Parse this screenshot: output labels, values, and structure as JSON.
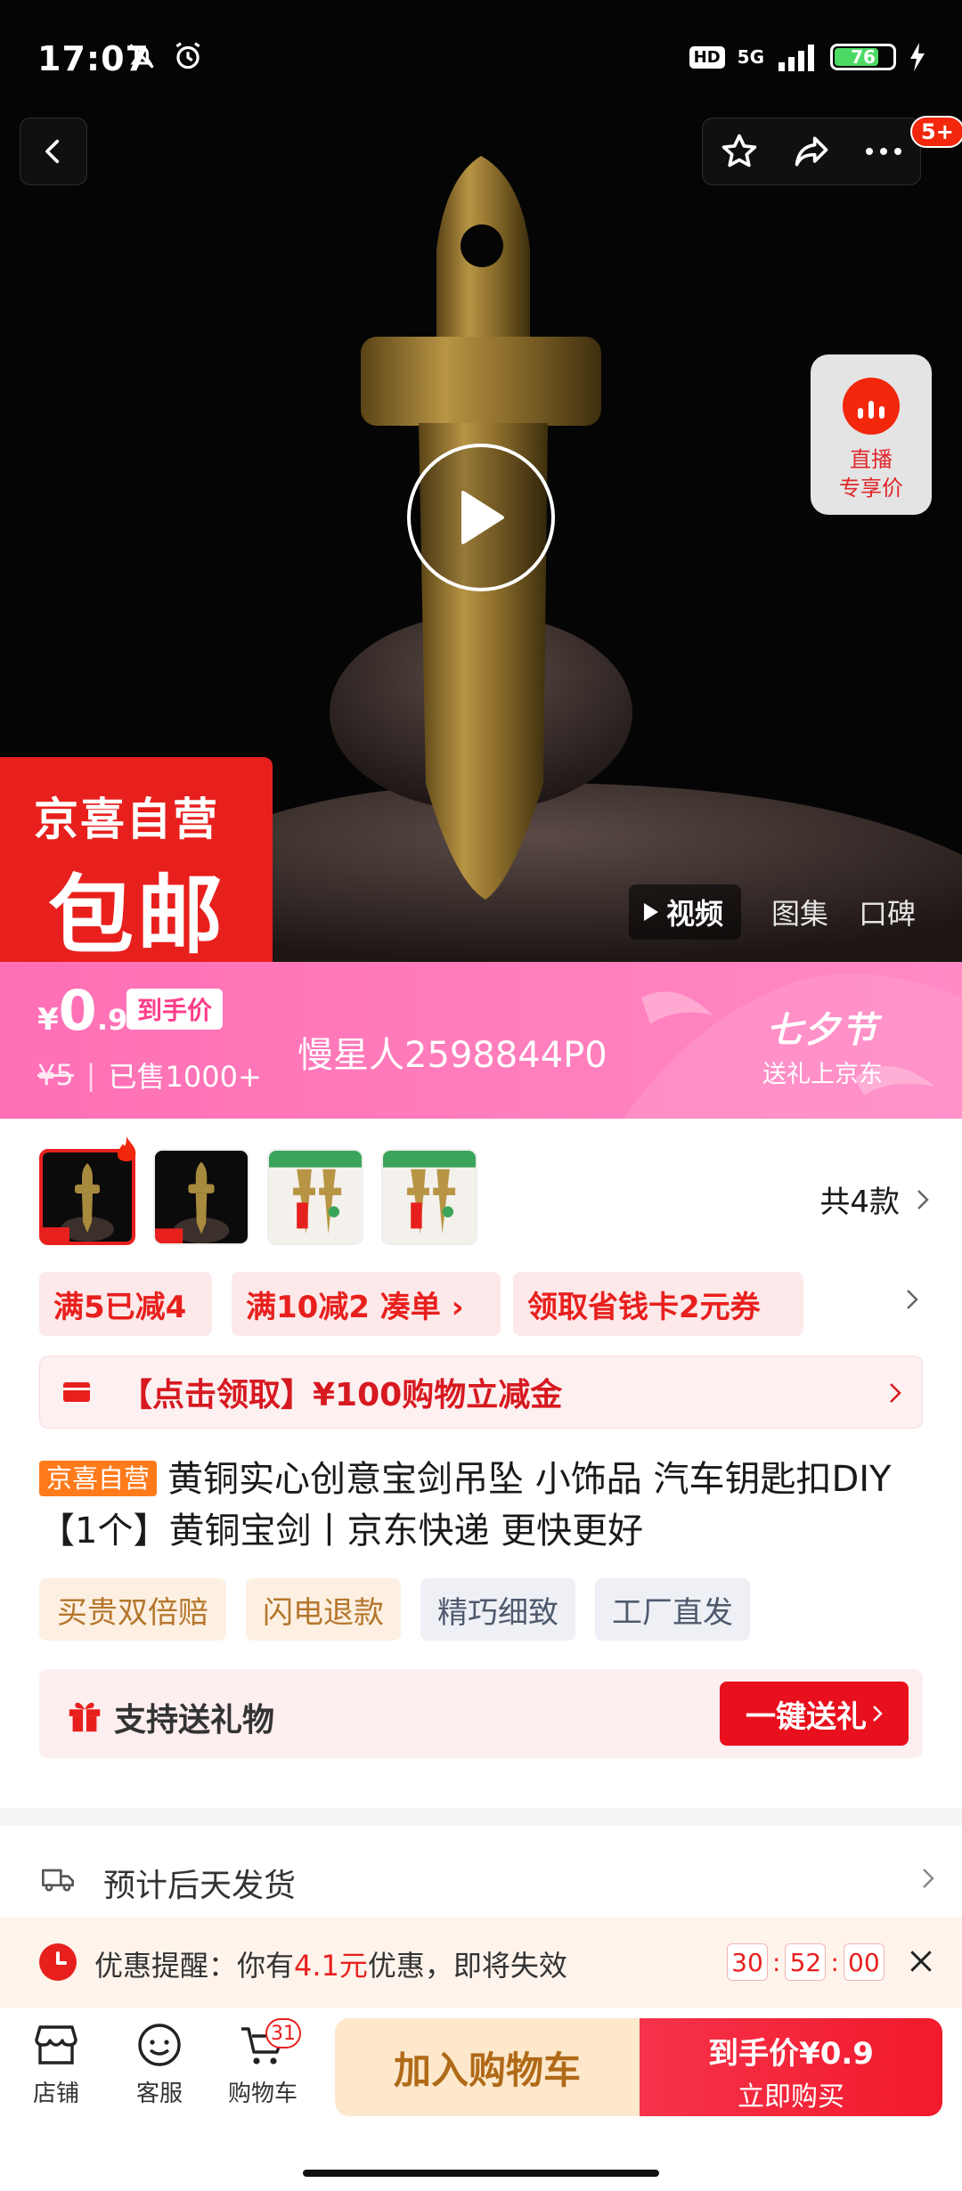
{
  "status_bar": {
    "time": "17:07",
    "hd": "HD",
    "network": "5G",
    "battery": "76"
  },
  "header": {
    "message_badge": "5+"
  },
  "hero": {
    "live_label_line1": "直播",
    "live_label_line2": "专享价",
    "promo_line1": "京喜自营",
    "promo_line2": "包邮",
    "media_tabs": [
      "视频",
      "图集",
      "口碑"
    ]
  },
  "price": {
    "currency": "¥",
    "integer": "0",
    "decimal": ".9",
    "tag": "到手价",
    "original": "¥5",
    "separator": "|",
    "sold": "已售1000+",
    "shop_name": "慢星人2598844P0",
    "festival_title": "七夕节",
    "festival_sub": "送礼上京东"
  },
  "variants": {
    "count_label": "共4款"
  },
  "coupons": {
    "items": [
      "满5已减4",
      "满10减2  凑单 ›",
      "领取省钱卡2元券"
    ]
  },
  "voucher": {
    "text": "【点击领取】¥100购物立减金"
  },
  "product": {
    "badge": "京喜自营",
    "title": "黄铜实心创意宝剑吊坠 小饰品 汽车钥匙扣DIY 【1个】黄铜宝剑丨京东快递 更快更好"
  },
  "feature_tags": [
    "买贵双倍赔",
    "闪电退款",
    "精巧细致",
    "工厂直发"
  ],
  "gift": {
    "label": "支持送礼物",
    "button": "一键送礼"
  },
  "shipping": {
    "text": "预计后天发货"
  },
  "reminder": {
    "prefix": "优惠提醒：你有",
    "amount": "4.1元",
    "suffix": "优惠，即将失效",
    "countdown": [
      "30",
      "52",
      "00"
    ]
  },
  "bottom_bar": {
    "shop": "店铺",
    "service": "客服",
    "cart": "购物车",
    "cart_count": "31",
    "add_to_cart": "加入购物车",
    "buy_price_label": "到手价¥0.9",
    "buy_now": "立即购买"
  },
  "colors": {
    "jd_red": "#e8201d",
    "banner_pink": "#ff7fbd",
    "add_cart_bg": "#fde8cc"
  }
}
